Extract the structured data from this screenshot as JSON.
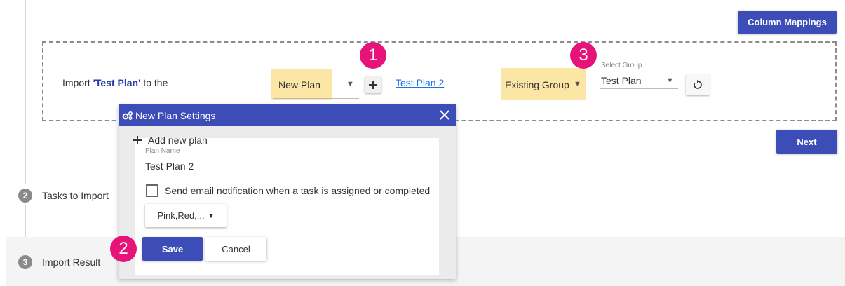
{
  "toolbar": {
    "column_mappings_label": "Column Mappings",
    "next_label": "Next"
  },
  "import_row": {
    "prefix": "Import",
    "plan_name": "'Test Plan'",
    "suffix": "to the",
    "plan_select": {
      "value": "New Plan"
    },
    "new_plan_link": "Test Plan 2",
    "group_select": {
      "value": "Existing Group"
    },
    "group_field": {
      "label": "Select Group",
      "value": "Test Plan"
    }
  },
  "badges": [
    "1",
    "2",
    "3"
  ],
  "steps": [
    {
      "number": "2",
      "label": "Tasks to Import"
    },
    {
      "number": "3",
      "label": "Import Result"
    }
  ],
  "dialog": {
    "title": "New Plan Settings",
    "add_new_plan": "Add new plan",
    "plan_name_label": "Plan Name",
    "plan_name_value": "Test Plan 2",
    "email_checkbox_label": "Send email notification when a task is assigned or completed",
    "labels_dropdown": "Pink,Red,...",
    "save_label": "Save",
    "cancel_label": "Cancel"
  },
  "colors": {
    "primary": "#3d4db7",
    "highlight": "#fbe6a5",
    "badge": "#e6147a",
    "link": "#1a73e8"
  },
  "icons": [
    "plus-icon",
    "refresh-icon",
    "gears-icon",
    "close-icon",
    "caret-down-icon"
  ]
}
